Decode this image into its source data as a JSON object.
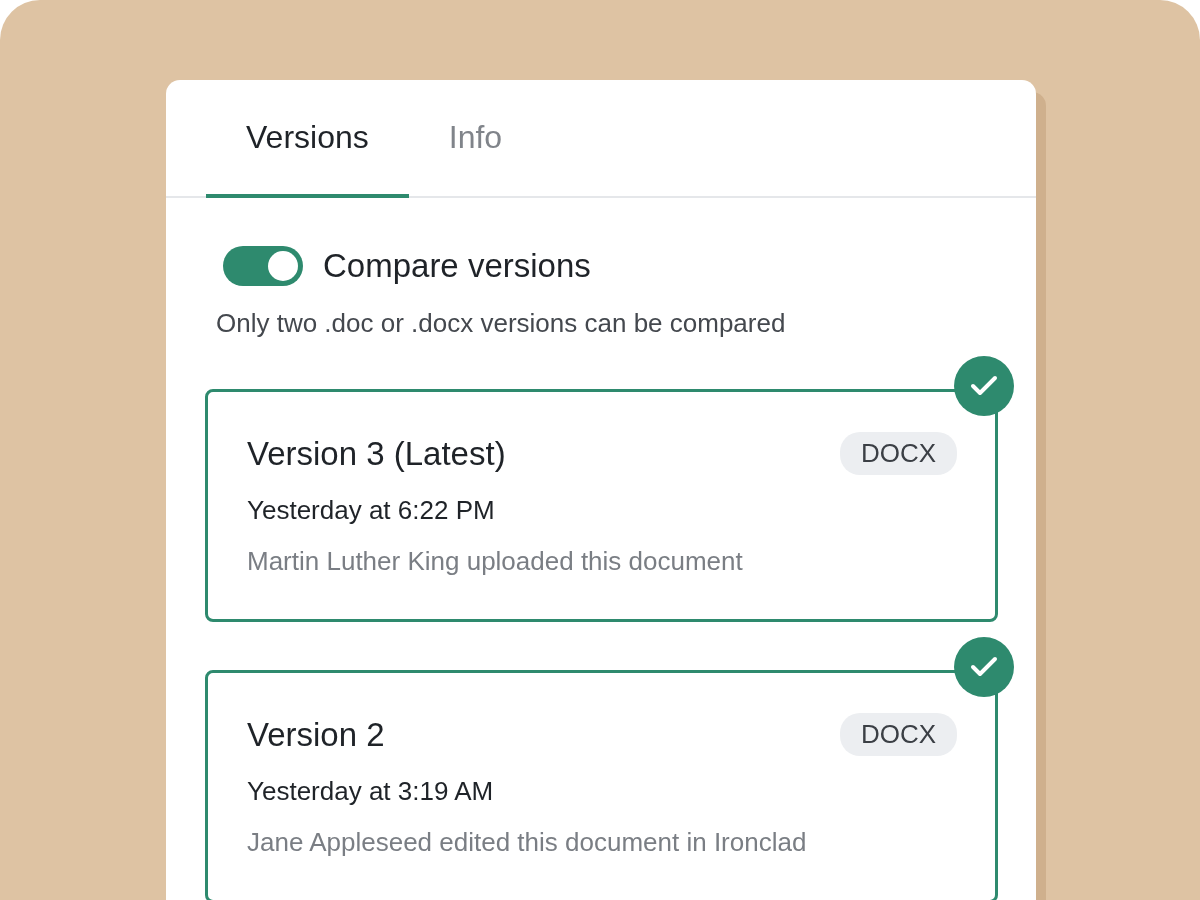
{
  "tabs": [
    {
      "label": "Versions",
      "selected": true
    },
    {
      "label": "Info",
      "selected": false
    }
  ],
  "compare": {
    "label": "Compare versions",
    "on": true,
    "hint": "Only two .doc or .docx versions can be compared"
  },
  "versions": [
    {
      "title": "Version 3 (Latest)",
      "badge": "DOCX",
      "time": "Yesterday at 6:22 PM",
      "activity": "Martin Luther King uploaded this document",
      "selected": true
    },
    {
      "title": "Version 2",
      "badge": "DOCX",
      "time": "Yesterday at 3:19 AM",
      "activity": "Jane Appleseed edited this document in Ironclad",
      "selected": true
    }
  ]
}
